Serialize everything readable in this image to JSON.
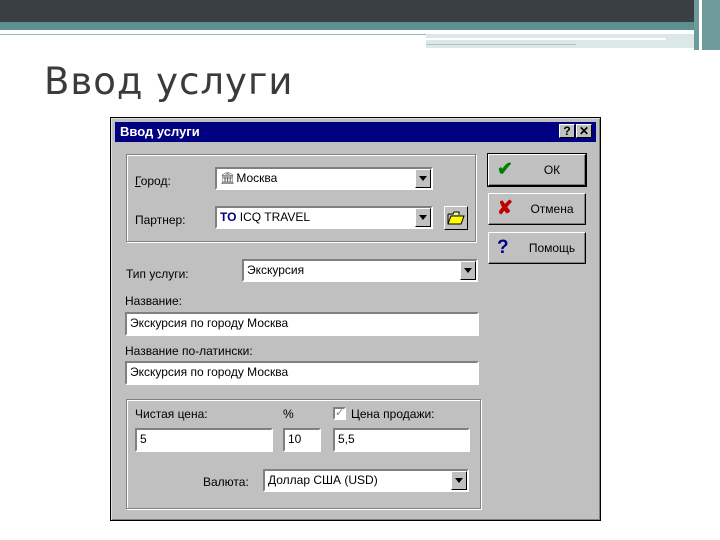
{
  "slide": {
    "title": "Ввод услуги"
  },
  "dialog": {
    "title": "Ввод услуги",
    "help_btn": "?",
    "close_btn": "✕",
    "city": {
      "label": "Город:",
      "value": "Москва",
      "icon": "building-icon"
    },
    "partner": {
      "label": "Партнер:",
      "prefix": "TO",
      "value": "ICQ TRAVEL",
      "icon": "folder-open-icon"
    },
    "service_type": {
      "label": "Тип услуги:",
      "value": "Экскурсия"
    },
    "name": {
      "label": "Название:",
      "value": "Экскурсия по городу Москва"
    },
    "name_latin": {
      "label": "Название по-латински:",
      "value": "Экскурсия по городу Москва"
    },
    "net_price": {
      "label": "Чистая цена:",
      "value": "5"
    },
    "percent": {
      "label": "%",
      "value": "10"
    },
    "sale_price": {
      "label": "Цена продажи:",
      "value": "5,5",
      "checked": true
    },
    "currency": {
      "label": "Валюта:",
      "value": "Доллар США (USD)"
    },
    "buttons": {
      "ok": {
        "label": "ОК",
        "icon": "checkmark-icon",
        "color": "#008000"
      },
      "cancel": {
        "label": "Отмена",
        "icon": "x-mark-icon",
        "color": "#c00000"
      },
      "help": {
        "label": "Помощь",
        "icon": "question-icon",
        "color": "#000080"
      }
    }
  }
}
